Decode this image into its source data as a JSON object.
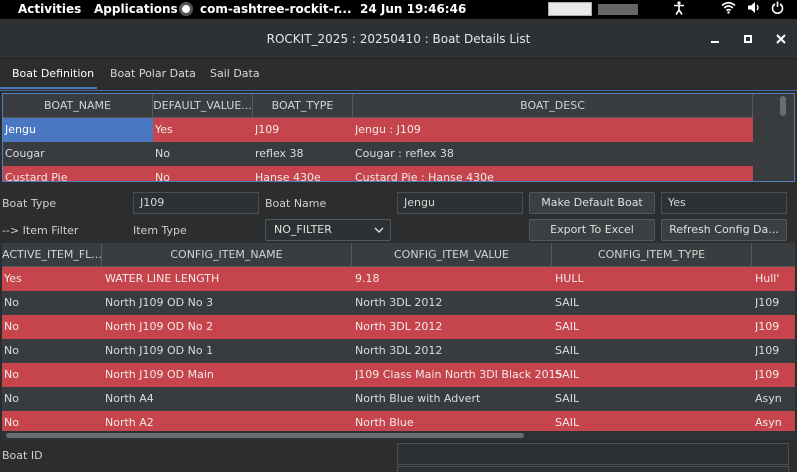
{
  "topbar": {
    "activities": "Activities",
    "applications": "Applications",
    "app_name": "com-ashtree-rockit-r...",
    "datetime": "24 Jun  19:46:46",
    "icons": [
      "accessibility-icon",
      "wifi-icon",
      "volume-icon",
      "power-icon"
    ]
  },
  "window": {
    "title": "ROCKIT_2025 : 20250410 : Boat Details List",
    "buttons": [
      "minimize",
      "maximize",
      "close"
    ]
  },
  "tabs": [
    {
      "label": "Boat Definition",
      "active": true
    },
    {
      "label": "Boat Polar Data",
      "active": false
    },
    {
      "label": "Sail Data",
      "active": false
    }
  ],
  "boat_table": {
    "headers": [
      "BOAT_NAME",
      "DEFAULT_VALUE...",
      "BOAT_TYPE",
      "BOAT_DESC"
    ],
    "rows": [
      {
        "cells": [
          "Jengu",
          "Yes",
          "J109",
          "Jengu : J109"
        ],
        "style": "red",
        "selected_first": true
      },
      {
        "cells": [
          "Cougar",
          "No",
          "reflex 38",
          "Cougar : reflex 38"
        ],
        "style": "dark"
      },
      {
        "cells": [
          "Custard Pie",
          "No",
          "Hanse 430e",
          "Custard Pie : Hanse 430e"
        ],
        "style": "red"
      }
    ]
  },
  "form": {
    "boat_type_label": "Boat Type",
    "boat_type_value": "J109",
    "boat_name_label": "Boat Name",
    "boat_name_value": "Jengu",
    "make_default_button": "Make Default Boat",
    "default_value": "Yes",
    "item_filter_label": "--> Item Filter",
    "item_type_label": "Item Type",
    "item_type_selected": "NO_FILTER",
    "export_button": "Export To Excel",
    "refresh_button": "Refresh Config Da..."
  },
  "config_table": {
    "headers": [
      "ACTIVE_ITEM_FL...",
      "CONFIG_ITEM_NAME",
      "CONFIG_ITEM_VALUE",
      "CONFIG_ITEM_TYPE",
      ""
    ],
    "rows": [
      {
        "cells": [
          "Yes",
          "WATER LINE LENGTH",
          "9.18",
          "HULL",
          "Hull'"
        ],
        "style": "red"
      },
      {
        "cells": [
          "No",
          "North J109 OD No 3",
          "North 3DL 2012",
          "SAIL",
          "J109"
        ],
        "style": "dark"
      },
      {
        "cells": [
          "No",
          "North J109 OD No 2",
          "North 3DL 2012",
          "SAIL",
          "J109"
        ],
        "style": "red"
      },
      {
        "cells": [
          "No",
          "North J109 OD No 1",
          "North 3DL 2012",
          "SAIL",
          "J109"
        ],
        "style": "dark"
      },
      {
        "cells": [
          "No",
          "North J109 OD Main",
          "J109 Class Main North 3DI Black 2015",
          "SAIL",
          "J109"
        ],
        "style": "red"
      },
      {
        "cells": [
          "No",
          "North A4",
          "North Blue with Advert",
          "SAIL",
          "Asyn"
        ],
        "style": "dark"
      },
      {
        "cells": [
          "No",
          "North A2",
          "North Blue",
          "SAIL",
          "Asyn"
        ],
        "style": "red"
      }
    ]
  },
  "footer": {
    "boat_id_label": "Boat ID",
    "boat_id_value": ""
  },
  "colors": {
    "row_red": "#c6444b",
    "row_dark": "#383c3e",
    "selection": "#4a78c0",
    "tab_accent": "#4e78b8"
  }
}
